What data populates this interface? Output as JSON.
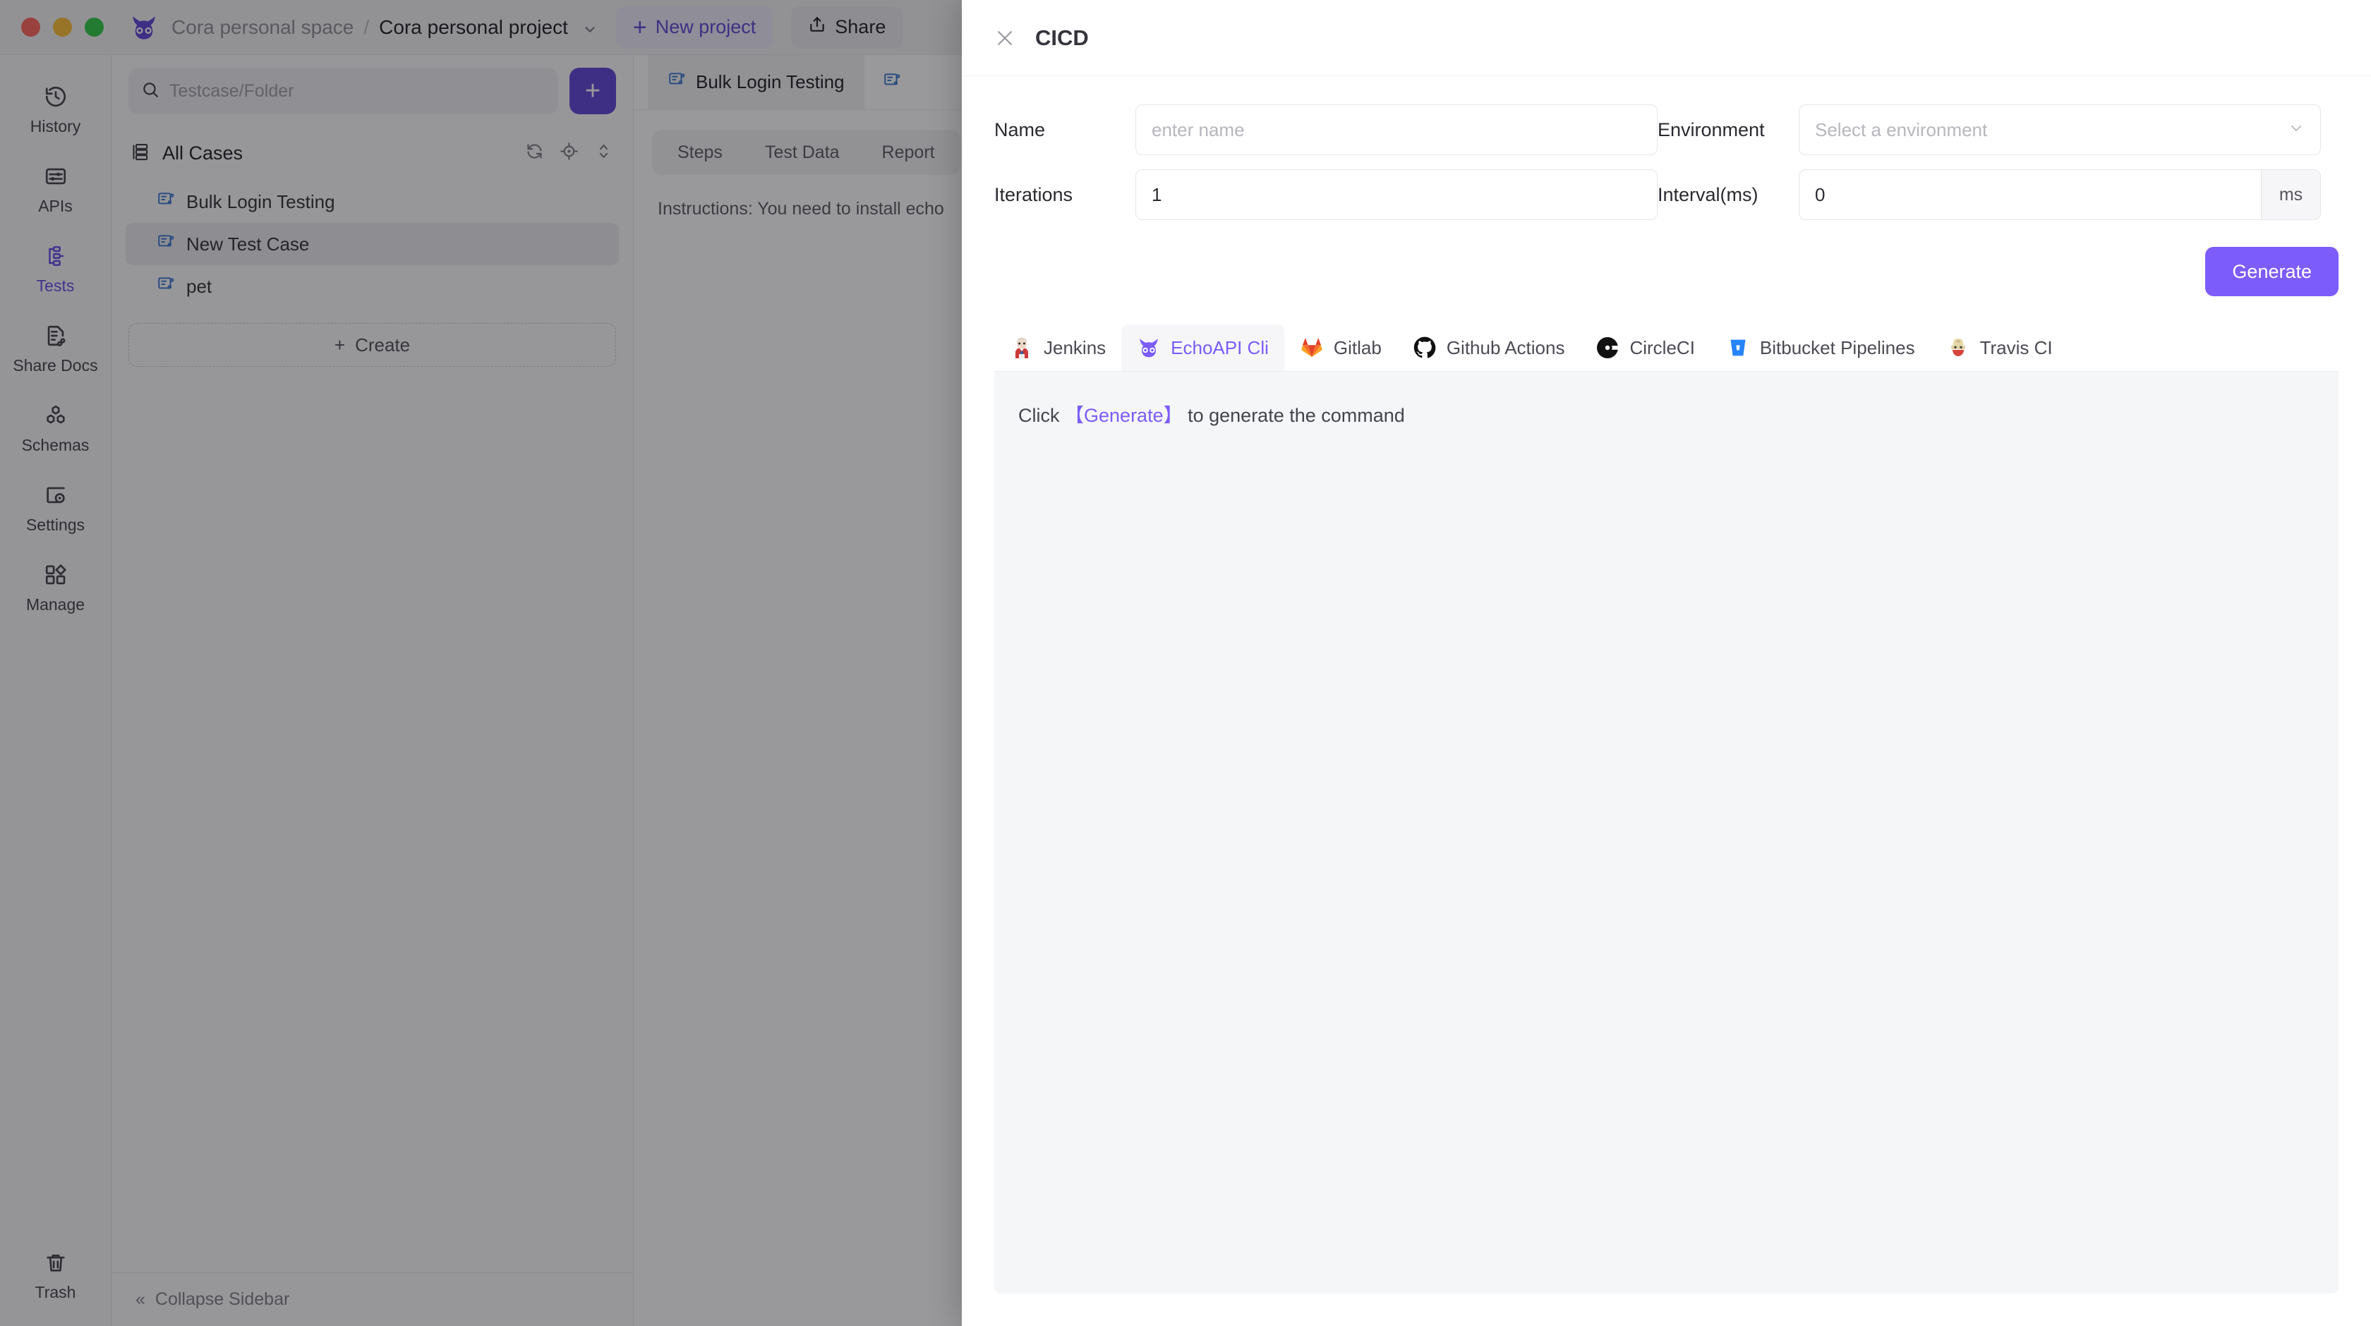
{
  "titlebar": {
    "breadcrumb": {
      "space": "Cora personal space",
      "separator": "/",
      "project": "Cora personal project"
    },
    "new_project_label": "New project",
    "new_project_plus": "+",
    "share_label": "Share"
  },
  "rail": {
    "items": [
      {
        "label": "History",
        "icon": "history-icon"
      },
      {
        "label": "APIs",
        "icon": "apis-icon"
      },
      {
        "label": "Tests",
        "icon": "tests-icon"
      },
      {
        "label": "Share Docs",
        "icon": "share-docs-icon"
      },
      {
        "label": "Schemas",
        "icon": "schemas-icon"
      },
      {
        "label": "Settings",
        "icon": "settings-icon"
      },
      {
        "label": "Manage",
        "icon": "manage-icon"
      }
    ],
    "bottom": {
      "label": "Trash",
      "icon": "trash-icon"
    }
  },
  "explorer": {
    "search_placeholder": "Testcase/Folder",
    "search_value": "",
    "add_label": "+",
    "all_cases_label": "All Cases",
    "cases": [
      {
        "label": "Bulk Login Testing"
      },
      {
        "label": "New Test Case"
      },
      {
        "label": "pet"
      }
    ],
    "selected_case_index": 1,
    "create_label": "Create",
    "create_plus": "+",
    "collapse_label": "Collapse Sidebar",
    "collapse_chevrons": "«"
  },
  "content": {
    "doc_tabs": [
      {
        "label": "Bulk Login Testing"
      }
    ],
    "inner_tabs": [
      {
        "label": "Steps"
      },
      {
        "label": "Test Data"
      },
      {
        "label": "Report"
      }
    ],
    "instructions": "Instructions: You need to install echo"
  },
  "modal": {
    "title": "CICD",
    "close_icon": "close-icon",
    "fields": {
      "name_label": "Name",
      "name_placeholder": "enter name",
      "name_value": "",
      "environment_label": "Environment",
      "environment_placeholder": "Select a environment",
      "environment_value": "",
      "iterations_label": "Iterations",
      "iterations_value": "1",
      "interval_label": "Interval(ms)",
      "interval_value": "0",
      "interval_suffix": "ms"
    },
    "generate_label": "Generate",
    "ci_tabs": [
      {
        "label": "Jenkins",
        "icon": "jenkins-icon"
      },
      {
        "label": "EchoAPI Cli",
        "icon": "echoapi-owl-icon"
      },
      {
        "label": "Gitlab",
        "icon": "gitlab-icon"
      },
      {
        "label": "Github Actions",
        "icon": "github-icon"
      },
      {
        "label": "CircleCI",
        "icon": "circleci-icon"
      },
      {
        "label": "Bitbucket Pipelines",
        "icon": "bitbucket-icon"
      },
      {
        "label": "Travis CI",
        "icon": "travis-icon"
      }
    ],
    "active_ci_tab_index": 1,
    "hint": {
      "prefix": "Click",
      "bracket_open": "【",
      "word": "Generate",
      "bracket_close": "】",
      "suffix": "to generate the command"
    }
  },
  "colors": {
    "accent_purple": "#7c5cfa",
    "brand_purple": "#5b3fd6",
    "panel_gray": "#f5f6f8"
  }
}
